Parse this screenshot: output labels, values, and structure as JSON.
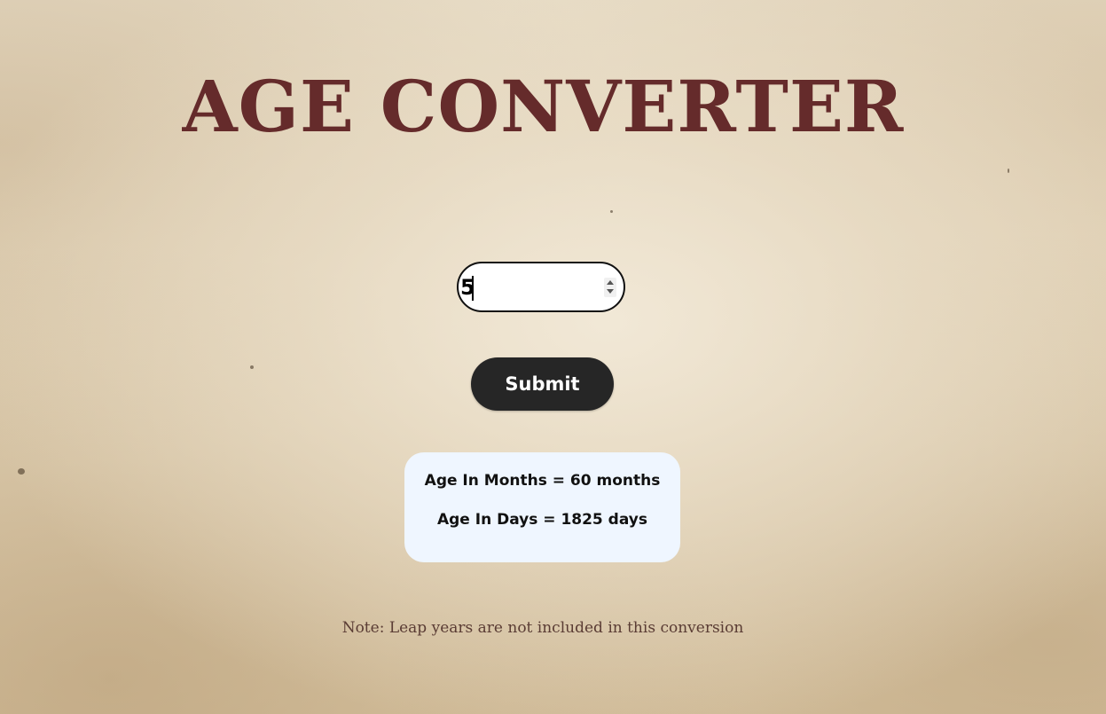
{
  "header": {
    "title": "AGE CONVERTER"
  },
  "form": {
    "age_input_value": "5",
    "submit_label": "Submit"
  },
  "results": {
    "months_text": "Age In Months = 60 months",
    "days_text": "Age In Days = 1825 days"
  },
  "footer": {
    "note": "Note: Leap years are not included in this conversion"
  },
  "colors": {
    "title": "#652b2b",
    "button_bg": "#262626",
    "button_text": "#ffffff",
    "result_bg": "#eff6ff",
    "note_text": "#5a3c34"
  }
}
